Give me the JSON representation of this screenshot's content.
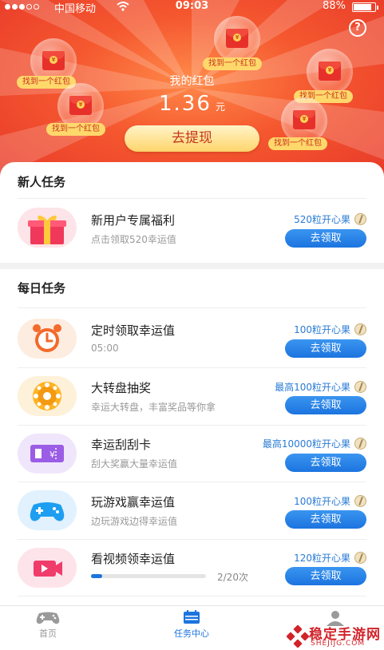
{
  "status_bar": {
    "carrier": "中国移动",
    "time": "09:03",
    "battery": "88%"
  },
  "header": {
    "help_label": "?",
    "my_hongbao_label": "我的红包",
    "amount": "1.36",
    "amount_unit": "元",
    "withdraw_label": "去提现",
    "envelope_coin": "¥",
    "found_tag": "找到一个红包"
  },
  "newbie_section": {
    "title": "新人任务",
    "tasks": [
      {
        "title": "新用户专属福利",
        "subtitle": "点击领取520幸运值",
        "reward": "520粒开心果",
        "button": "去领取",
        "icon": "gift-icon"
      }
    ]
  },
  "daily_section": {
    "title": "每日任务",
    "tasks": [
      {
        "title": "定时领取幸运值",
        "subtitle": "05:00",
        "reward": "100粒开心果",
        "button": "去领取",
        "icon": "alarm-clock-icon"
      },
      {
        "title": "大转盘抽奖",
        "subtitle": "幸运大转盘，丰富奖品等你拿",
        "reward": "最高100粒开心果",
        "button": "去领取",
        "icon": "lucky-wheel-icon"
      },
      {
        "title": "幸运刮刮卡",
        "subtitle": "刮大奖赢大量幸运值",
        "reward": "最高10000粒开心果",
        "button": "去领取",
        "icon": "scratch-card-icon"
      },
      {
        "title": "玩游戏赢幸运值",
        "subtitle": "边玩游戏边得幸运值",
        "reward": "100粒开心果",
        "button": "去领取",
        "icon": "gamepad-icon"
      },
      {
        "title": "看视频领幸运值",
        "reward": "120粒开心果",
        "button": "去领取",
        "icon": "video-camera-icon",
        "progress_text": "2/20次",
        "progress_fraction": 0.1
      }
    ]
  },
  "tabbar": {
    "tabs": [
      {
        "label": "首页",
        "icon": "gamepad-icon",
        "active": false
      },
      {
        "label": "任务中心",
        "icon": "calendar-icon",
        "active": true
      },
      {
        "label": "",
        "icon": "user-icon",
        "active": false
      }
    ]
  },
  "watermark": {
    "text": "稳定手游网",
    "sub": "SHEJIJG.COM"
  },
  "colors": {
    "header_red": "#e83a2a",
    "button_blue": "#1c74df",
    "reward_blue": "#2a7bd6",
    "tag_yellow": "#ffd86b"
  }
}
